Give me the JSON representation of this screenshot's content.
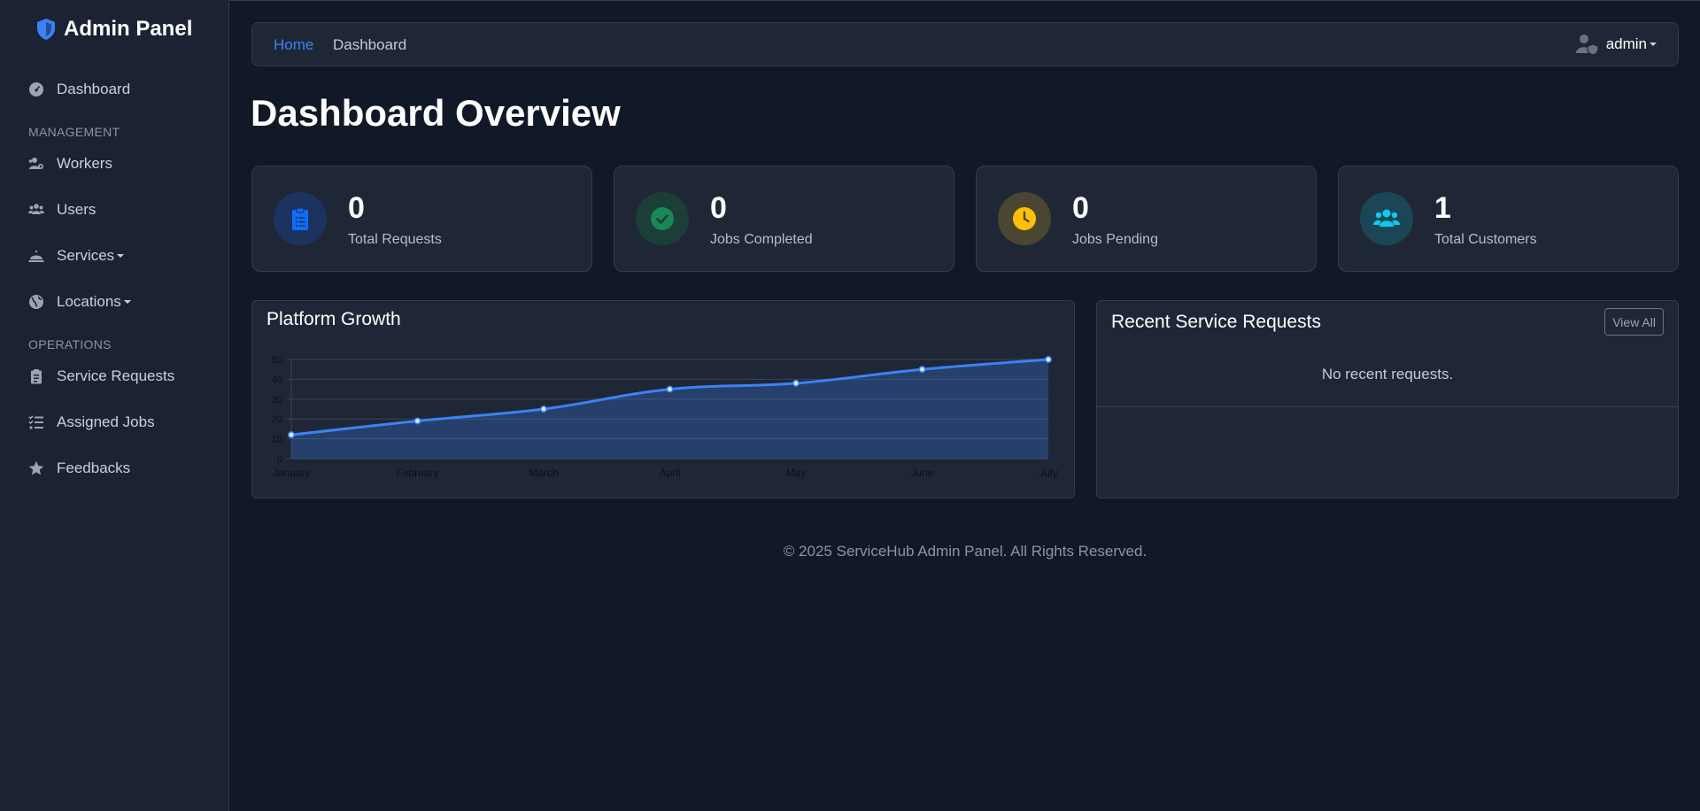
{
  "brand": {
    "title": "Admin Panel",
    "icon": "shield-icon",
    "accent": "#3b82f6"
  },
  "sidebar": {
    "items": [
      {
        "label": "Dashboard",
        "icon": "gauge-icon"
      },
      {
        "section": "MANAGEMENT"
      },
      {
        "label": "Workers",
        "icon": "users-gear-icon"
      },
      {
        "label": "Users",
        "icon": "users-icon"
      },
      {
        "label": "Services",
        "icon": "bell-concierge-icon",
        "dropdown": true
      },
      {
        "label": "Locations",
        "icon": "globe-icon",
        "dropdown": true
      },
      {
        "section": "OPERATIONS"
      },
      {
        "label": "Service Requests",
        "icon": "clipboard-list-icon"
      },
      {
        "label": "Assigned Jobs",
        "icon": "list-check-icon"
      },
      {
        "label": "Feedbacks",
        "icon": "star-icon"
      }
    ]
  },
  "topbar": {
    "breadcrumb": {
      "home": "Home",
      "current": "Dashboard"
    },
    "user": {
      "name": "admin",
      "icon": "user-shield-icon"
    }
  },
  "page": {
    "title": "Dashboard Overview"
  },
  "stats": [
    {
      "value": "0",
      "label": "Total Requests",
      "icon": "clipboard-list-icon",
      "color": "#0d6efd"
    },
    {
      "value": "0",
      "label": "Jobs Completed",
      "icon": "check-circle-icon",
      "color": "#198754"
    },
    {
      "value": "0",
      "label": "Jobs Pending",
      "icon": "clock-icon",
      "color": "#ffc107"
    },
    {
      "value": "1",
      "label": "Total Customers",
      "icon": "users-icon",
      "color": "#0dcaf0"
    }
  ],
  "growth": {
    "title": "Platform Growth",
    "chart_data": {
      "type": "area",
      "categories": [
        "January",
        "February",
        "March",
        "April",
        "May",
        "June",
        "July"
      ],
      "series": [
        {
          "values": [
            12,
            19,
            25,
            35,
            38,
            45,
            50
          ]
        }
      ],
      "ylim": [
        0,
        50
      ],
      "yticks": [
        0,
        10,
        20,
        30,
        40,
        50
      ],
      "grid": true,
      "line_color": "#3b82f6"
    }
  },
  "recent": {
    "title": "Recent Service Requests",
    "view_all": "View All",
    "empty": "No recent requests."
  },
  "footer": {
    "text": "© 2025 ServiceHub Admin Panel. All Rights Reserved."
  }
}
